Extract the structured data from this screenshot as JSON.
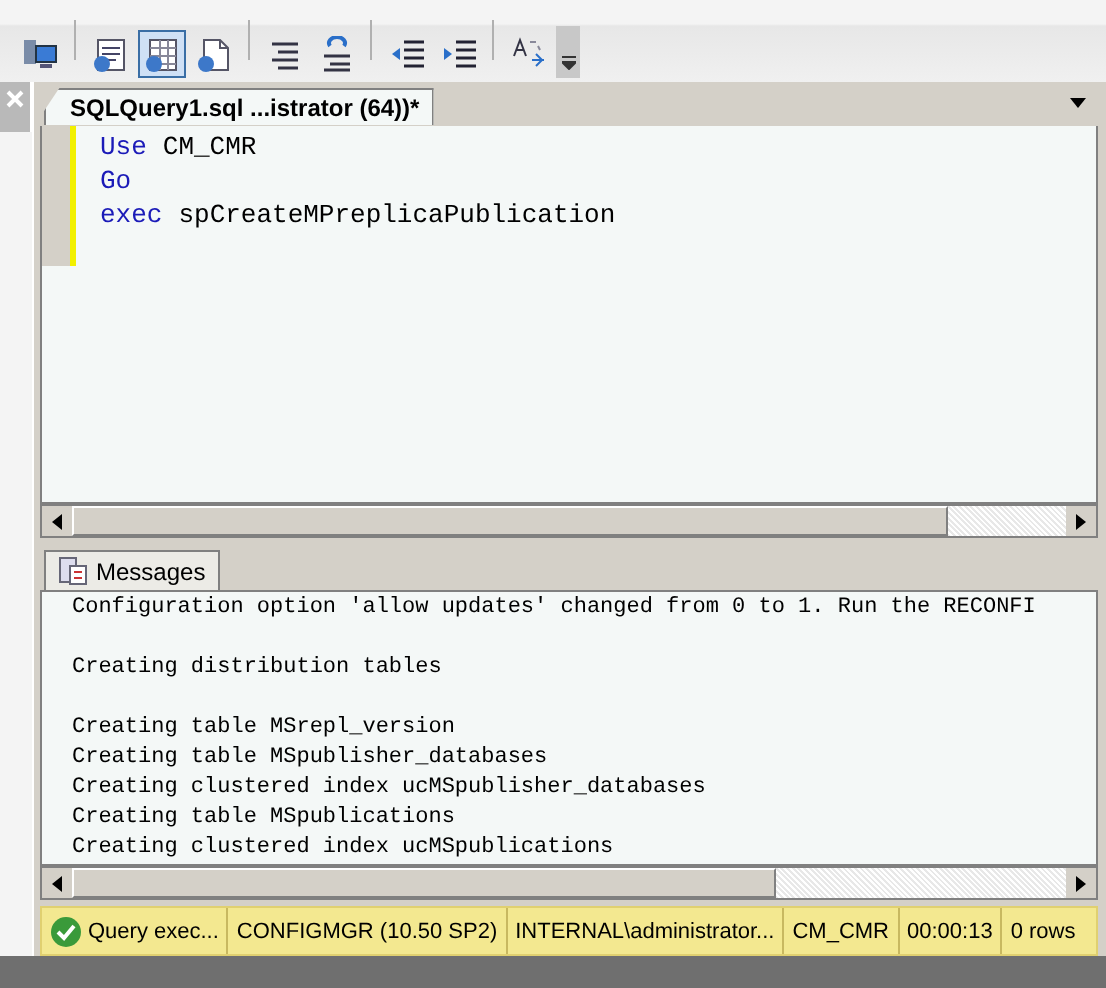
{
  "toolbar": {
    "buttons": [
      {
        "kind": "server",
        "selected": false
      },
      {
        "kind": "text-results",
        "selected": false
      },
      {
        "kind": "grid-results",
        "selected": true
      },
      {
        "kind": "file-results",
        "selected": false
      },
      {
        "kind": "comment",
        "selected": false
      },
      {
        "kind": "uncomment",
        "selected": false
      },
      {
        "kind": "outdent",
        "selected": false
      },
      {
        "kind": "indent",
        "selected": false
      },
      {
        "kind": "template",
        "selected": false
      },
      {
        "kind": "overflow",
        "selected": false
      }
    ]
  },
  "document_tab": {
    "title": "SQLQuery1.sql ...istrator (64))*",
    "selected": true
  },
  "editor": {
    "lines": [
      {
        "tokens": [
          {
            "kind": "keyword",
            "text": "Use"
          },
          {
            "kind": "plain",
            "text": "CM_CMR"
          }
        ]
      },
      {
        "tokens": [
          {
            "kind": "keyword",
            "text": "Go"
          }
        ]
      },
      {
        "tokens": [
          {
            "kind": "keyword",
            "text": "exec"
          },
          {
            "kind": "plain",
            "text": "spCreateMPreplicaPublication"
          }
        ]
      }
    ]
  },
  "results_tabs": [
    {
      "label": "Messages",
      "selected": true
    }
  ],
  "message_groups": [
    [
      "Configuration option 'allow updates' changed from 0 to 1. Run the RECONFI"
    ],
    [
      "Creating distribution tables"
    ],
    [
      "Creating table MSrepl_version",
      "Creating table MSpublisher_databases",
      "Creating clustered index ucMSpublisher_databases",
      "Creating table MSpublications",
      "Creating clustered index ucMSpublications"
    ]
  ],
  "status_bar": [
    {
      "kind": "success",
      "text": "Query exec..."
    },
    {
      "kind": "plain",
      "text": "CONFIGMGR (10.50 SP2)"
    },
    {
      "kind": "plain",
      "text": "INTERNAL\\administrator..."
    },
    {
      "kind": "plain",
      "text": "CM_CMR"
    },
    {
      "kind": "plain",
      "text": "00:00:13"
    },
    {
      "kind": "plain",
      "text": "0 rows"
    }
  ]
}
